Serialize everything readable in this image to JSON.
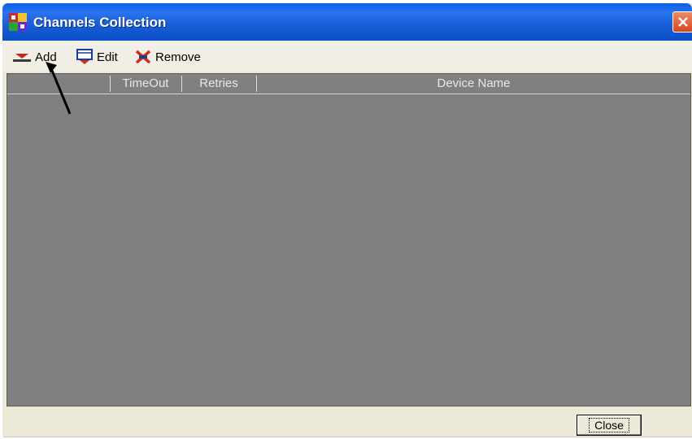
{
  "window": {
    "title": "Channels Collection",
    "title_color": "#0a5fe3",
    "icon": "app-grid-icon"
  },
  "toolbar": {
    "add_label": "Add",
    "edit_label": "Edit",
    "remove_label": "Remove"
  },
  "list": {
    "columns": [
      "",
      "TimeOut",
      "Retries",
      "Device Name"
    ],
    "rows": [],
    "background": "#808080"
  },
  "footer": {
    "close_label": "Close"
  }
}
